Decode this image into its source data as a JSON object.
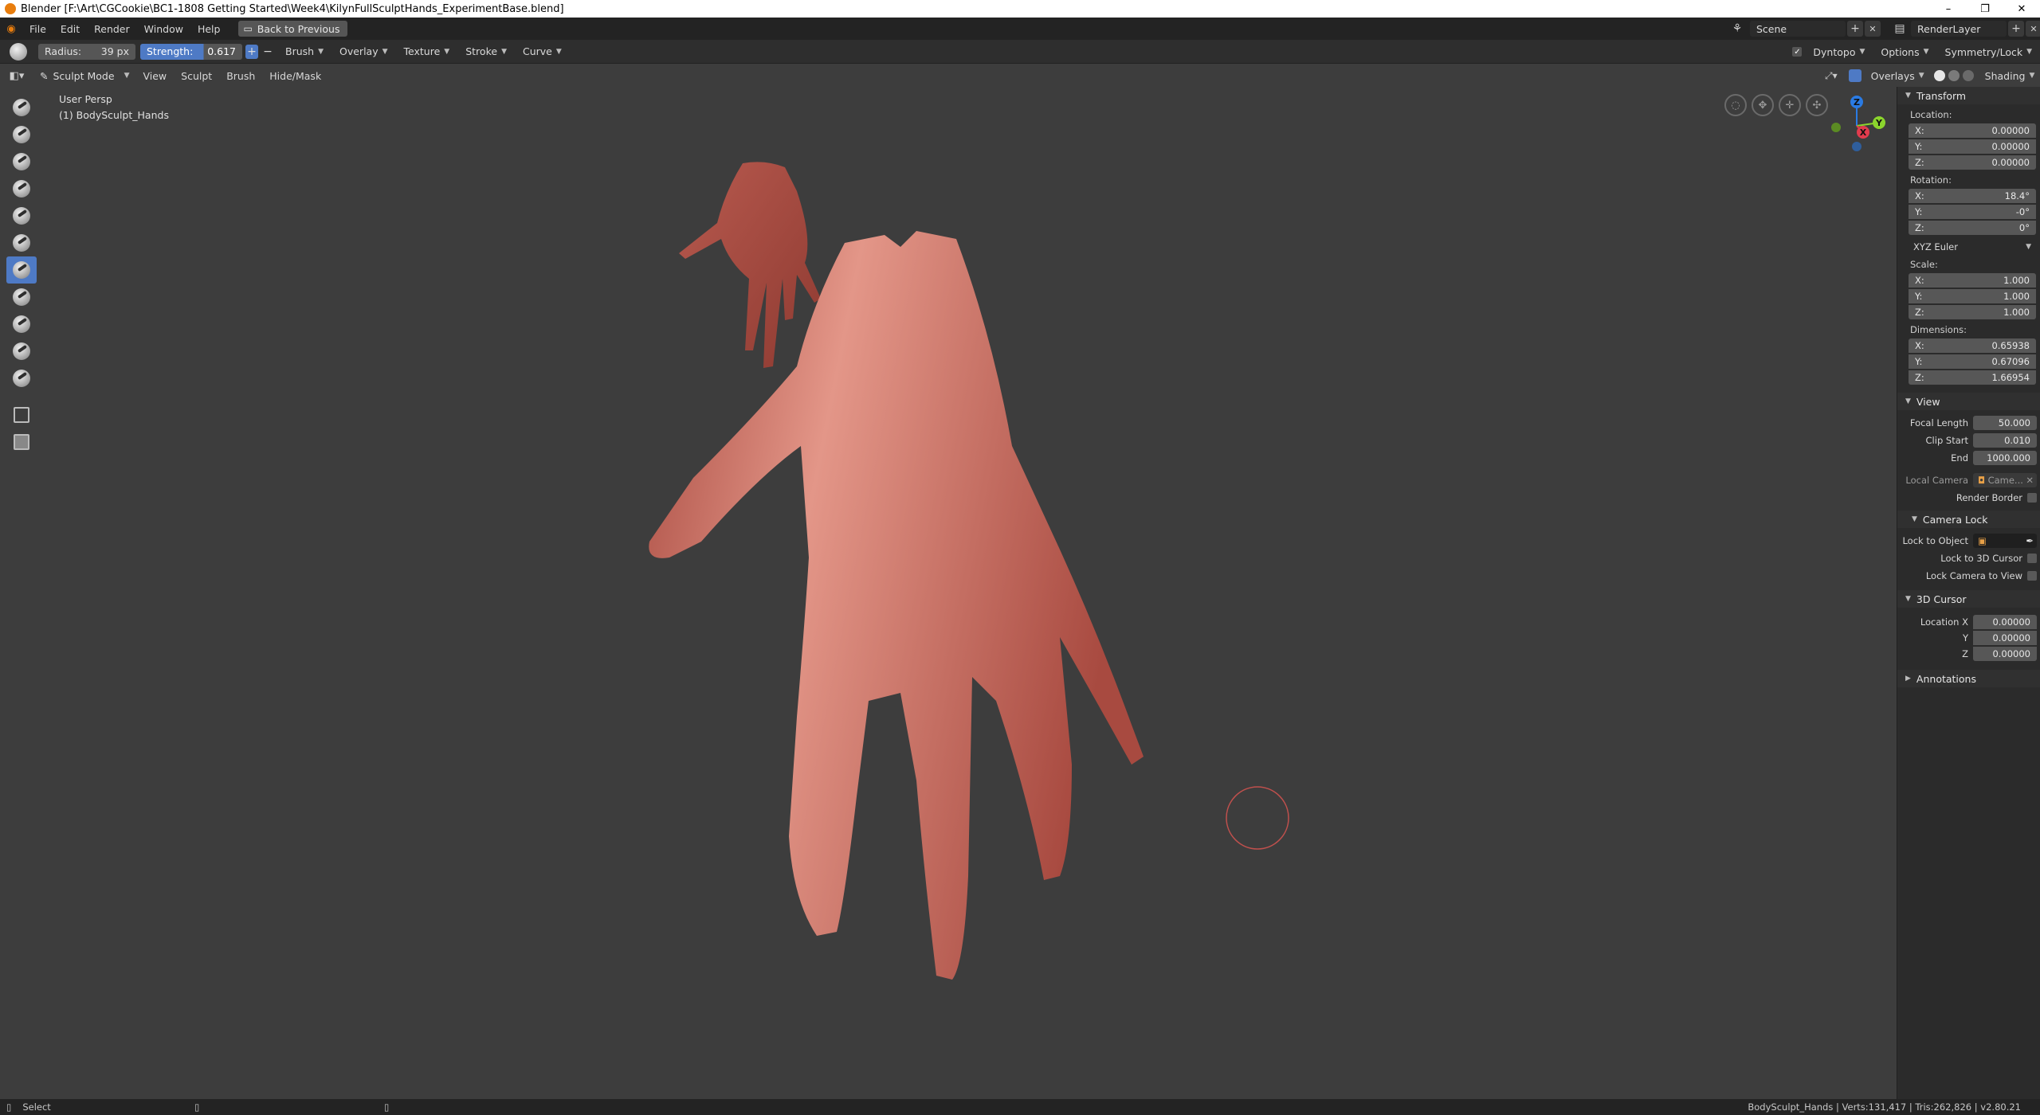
{
  "window": {
    "title": "Blender [F:\\Art\\CGCookie\\BC1-1808 Getting Started\\Week4\\KilynFullSculptHands_ExperimentBase.blend]",
    "minimize": "–",
    "maximize": "❐",
    "close": "✕"
  },
  "topbar": {
    "menus": [
      "File",
      "Edit",
      "Render",
      "Window",
      "Help"
    ],
    "back_button": "Back to Previous",
    "scene": "Scene",
    "render_layer": "RenderLayer"
  },
  "tool_settings": {
    "radius_label": "Radius:",
    "radius_value": "39 px",
    "strength_label": "Strength:",
    "strength_value": "0.617",
    "strength_fraction": 0.617,
    "plus": "+",
    "minus": "−",
    "menus": [
      "Brush",
      "Overlay",
      "Texture",
      "Stroke",
      "Curve"
    ],
    "dyntopo": "Dyntopo",
    "options": "Options",
    "symmetry": "Symmetry/Lock"
  },
  "viewport_header": {
    "mode": "Sculpt Mode",
    "menus": [
      "View",
      "Sculpt",
      "Brush",
      "Hide/Mask"
    ],
    "overlays": "Overlays",
    "shading": "Shading"
  },
  "viewport": {
    "perspective": "User Persp",
    "object": "(1) BodySculpt_Hands",
    "gizmo": {
      "z": "Z",
      "y": "Y",
      "x": "X"
    }
  },
  "sidebar": {
    "transform_title": "Transform",
    "location_label": "Location:",
    "location": [
      {
        "axis": "X:",
        "value": "0.00000"
      },
      {
        "axis": "Y:",
        "value": "0.00000"
      },
      {
        "axis": "Z:",
        "value": "0.00000"
      }
    ],
    "rotation_label": "Rotation:",
    "rotation": [
      {
        "axis": "X:",
        "value": "18.4°"
      },
      {
        "axis": "Y:",
        "value": "-0°"
      },
      {
        "axis": "Z:",
        "value": "0°"
      }
    ],
    "rotation_mode": "XYZ Euler",
    "scale_label": "Scale:",
    "scale": [
      {
        "axis": "X:",
        "value": "1.000"
      },
      {
        "axis": "Y:",
        "value": "1.000"
      },
      {
        "axis": "Z:",
        "value": "1.000"
      }
    ],
    "dimensions_label": "Dimensions:",
    "dimensions": [
      {
        "axis": "X:",
        "value": "0.65938"
      },
      {
        "axis": "Y:",
        "value": "0.67096"
      },
      {
        "axis": "Z:",
        "value": "1.66954"
      }
    ],
    "view_title": "View",
    "focal_length_label": "Focal Length",
    "focal_length": "50.000",
    "clip_start_label": "Clip Start",
    "clip_start": "0.010",
    "clip_end_label": "End",
    "clip_end": "1000.000",
    "local_camera_label": "Local Camera",
    "local_camera": "Came...",
    "render_border_label": "Render Border",
    "camera_lock_title": "Camera Lock",
    "lock_to_object_label": "Lock to Object",
    "lock_to_cursor_label": "Lock to 3D Cursor",
    "lock_camera_label": "Lock Camera to View",
    "cursor_title": "3D Cursor",
    "cursor_location_label": "Location X",
    "cursor_x": "0.00000",
    "cursor_y_label": "Y",
    "cursor_y": "0.00000",
    "cursor_z_label": "Z",
    "cursor_z": "0.00000",
    "annotations_title": "Annotations"
  },
  "statusbar": {
    "select": "Select",
    "stats": "BodySculpt_Hands | Verts:131,417 | Tris:262,826 | v2.80.21"
  },
  "colors": {
    "accent": "#4e7ac5",
    "viewport_bg": "#3d3d3d",
    "clay": "#c96b5f",
    "brush_circle": "#c0504d"
  }
}
